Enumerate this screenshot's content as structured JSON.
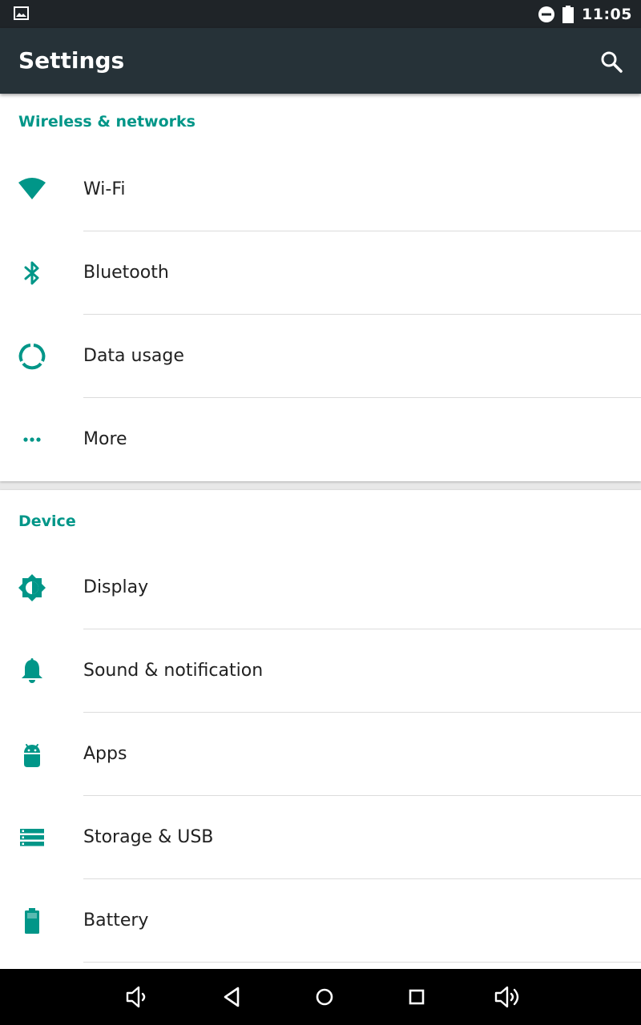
{
  "status_bar": {
    "time": "11:05",
    "icons": [
      "image-notification-icon",
      "do-not-disturb-icon",
      "battery-icon"
    ]
  },
  "app_bar": {
    "title": "Settings",
    "search_icon": "search-icon"
  },
  "sections": {
    "wireless": {
      "header": "Wireless & networks",
      "items": [
        {
          "label": "Wi-Fi",
          "icon": "wifi-icon"
        },
        {
          "label": "Bluetooth",
          "icon": "bluetooth-icon"
        },
        {
          "label": "Data usage",
          "icon": "data-usage-icon"
        },
        {
          "label": "More",
          "icon": "more-dots-icon"
        }
      ]
    },
    "device": {
      "header": "Device",
      "items": [
        {
          "label": "Display",
          "icon": "brightness-icon"
        },
        {
          "label": "Sound & notification",
          "icon": "bell-icon"
        },
        {
          "label": "Apps",
          "icon": "android-icon"
        },
        {
          "label": "Storage & USB",
          "icon": "storage-icon"
        },
        {
          "label": "Battery",
          "icon": "battery-icon"
        }
      ]
    }
  },
  "nav_bar": {
    "buttons": [
      "volume-down-icon",
      "back-icon",
      "home-icon",
      "recents-icon",
      "volume-up-icon"
    ]
  },
  "colors": {
    "accent": "#009688",
    "app_bar": "#263238",
    "status_bar": "#1f2428",
    "background": "#e8e8e8",
    "text_primary": "#212121"
  }
}
